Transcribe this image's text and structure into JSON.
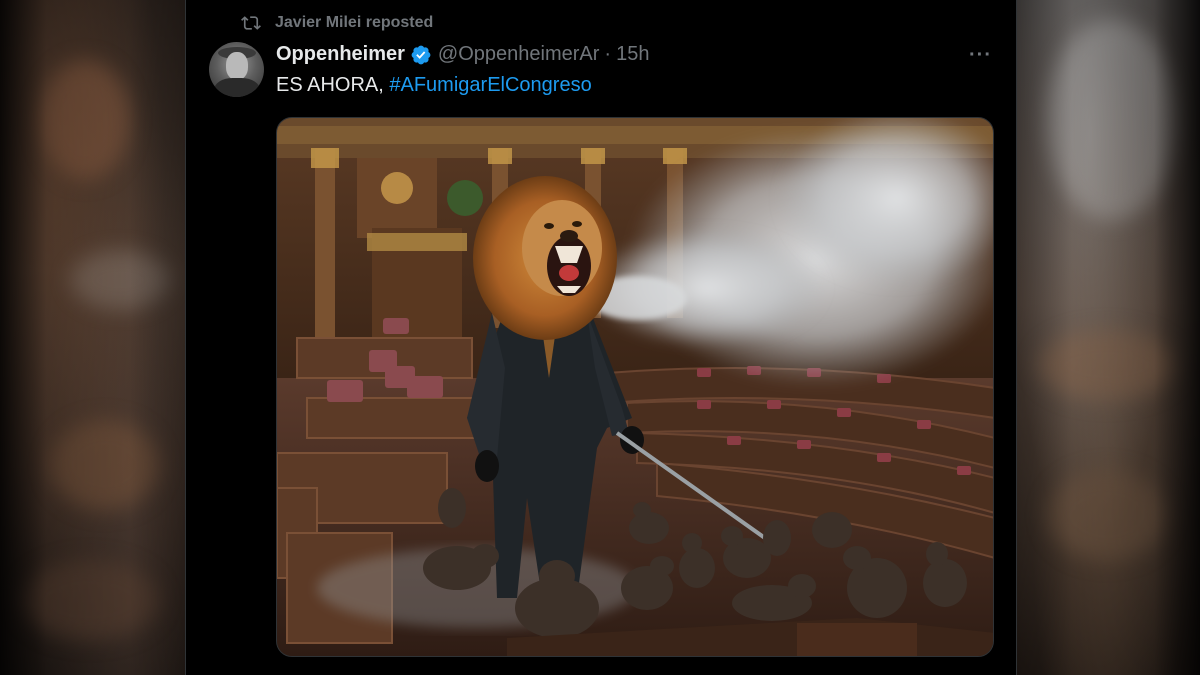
{
  "repost": {
    "label": "Javier Milei reposted",
    "icon": "repost-icon"
  },
  "author": {
    "name": "Oppenheimer",
    "verified_icon": "verified-badge-icon",
    "handle": "@OppenheimerAr",
    "separator": "·",
    "time": "15h"
  },
  "more_label": "···",
  "tweet": {
    "text_prefix": "ES AHORA,",
    "hashtag": "#AFumigarElCongreso"
  },
  "colors": {
    "link": "#1d9bf0",
    "muted": "#71767b",
    "text": "#e7e9ea",
    "verified": "#1d9bf0"
  }
}
